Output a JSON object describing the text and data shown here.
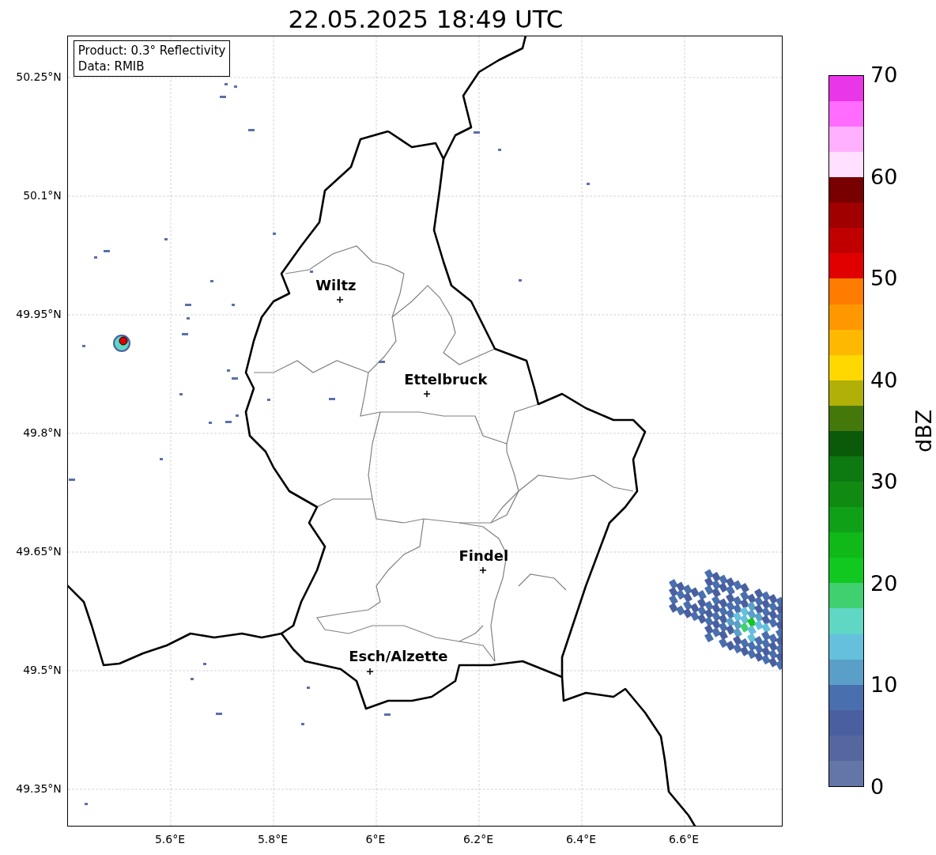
{
  "title": "22.05.2025 18:49 UTC",
  "info_box": {
    "lines": [
      "Product: 0.3° Reflectivity",
      "Data: RMIB"
    ]
  },
  "cities": [
    {
      "name": "Wiltz"
    },
    {
      "name": "Ettelbruck"
    },
    {
      "name": "Findel"
    },
    {
      "name": "Esch/Alzette"
    }
  ],
  "y_ticks": [
    "50.25°N",
    "50.1°N",
    "49.95°N",
    "49.8°N",
    "49.65°N",
    "49.5°N",
    "49.35°N"
  ],
  "x_ticks": [
    "5.6°E",
    "5.8°E",
    "6°E",
    "6.2°E",
    "6.4°E",
    "6.6°E"
  ],
  "colorbar": {
    "label": "dBZ",
    "ticks": [
      "70",
      "60",
      "50",
      "40",
      "30",
      "20",
      "10",
      "0"
    ],
    "bins": [
      {
        "color": "#6475a8"
      },
      {
        "color": "#56679f"
      },
      {
        "color": "#4a5fa0"
      },
      {
        "color": "#4a6fae"
      },
      {
        "color": "#5a9fc8"
      },
      {
        "color": "#64c0dc"
      },
      {
        "color": "#60d6c4"
      },
      {
        "color": "#40d070"
      },
      {
        "color": "#10c820"
      },
      {
        "color": "#10b818"
      },
      {
        "color": "#10a018"
      },
      {
        "color": "#108a10"
      },
      {
        "color": "#0c7a10"
      },
      {
        "color": "#0a5a0a"
      },
      {
        "color": "#44780a"
      },
      {
        "color": "#b0b008"
      },
      {
        "color": "#ffd800"
      },
      {
        "color": "#ffb800"
      },
      {
        "color": "#ff9800"
      },
      {
        "color": "#ff7c00"
      },
      {
        "color": "#e00000"
      },
      {
        "color": "#c00000"
      },
      {
        "color": "#a00000"
      },
      {
        "color": "#780000"
      },
      {
        "color": "#ffe0ff"
      },
      {
        "color": "#ffb0ff"
      },
      {
        "color": "#ff6cff"
      },
      {
        "color": "#e836e8"
      }
    ]
  }
}
